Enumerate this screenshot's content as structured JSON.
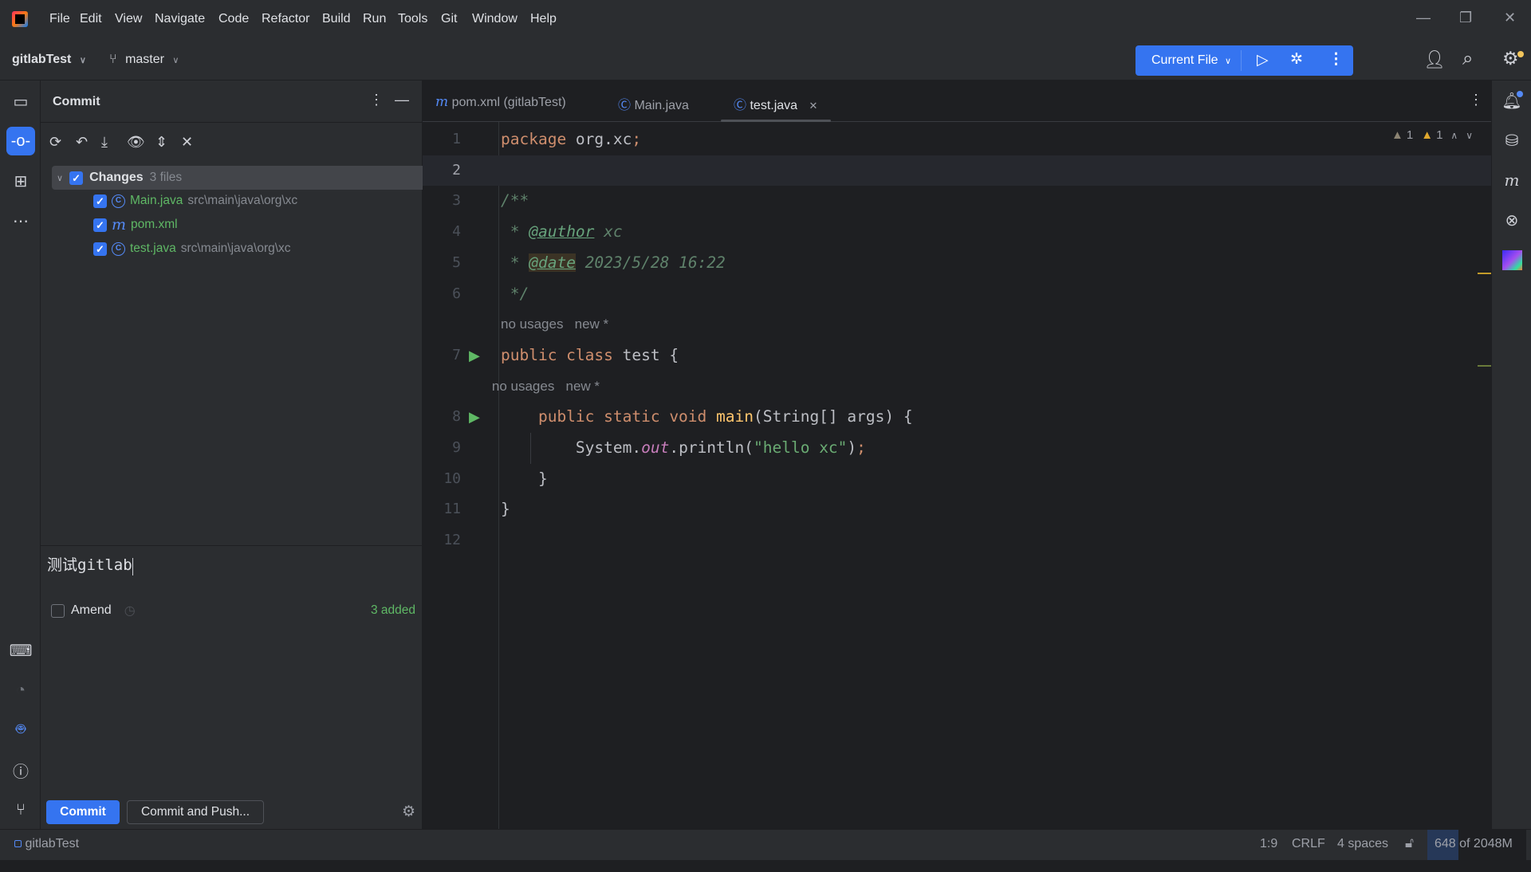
{
  "menubar": {
    "items": [
      "File",
      "Edit",
      "View",
      "Navigate",
      "Code",
      "Refactor",
      "Build",
      "Run",
      "Tools",
      "Git",
      "Window",
      "Help"
    ],
    "window_controls": [
      "minimize",
      "restore",
      "close"
    ]
  },
  "toolbar": {
    "project": "gitlabTest",
    "branch": "master",
    "run_config": "Current File"
  },
  "commit_panel": {
    "title": "Commit",
    "changes_label": "Changes",
    "changes_count": "3 files",
    "files": [
      {
        "name": "Main.java",
        "path": "src\\main\\java\\org\\xc",
        "icon": "class-icon"
      },
      {
        "name": "pom.xml",
        "path": "",
        "icon": "maven-icon"
      },
      {
        "name": "test.java",
        "path": "src\\main\\java\\org\\xc",
        "icon": "class-icon"
      }
    ],
    "amend_label": "Amend",
    "added_status": "3 added",
    "message": "测试gitlab",
    "commit_button": "Commit",
    "commit_push_button": "Commit and Push..."
  },
  "editor": {
    "tabs": [
      {
        "label": "pom.xml (gitlabTest)",
        "icon": "maven-icon"
      },
      {
        "label": "Main.java",
        "icon": "class-icon"
      },
      {
        "label": "test.java",
        "icon": "class-icon",
        "active": true
      }
    ],
    "warnings_weak": "1",
    "warnings": "1",
    "rows": [
      {
        "ln": "1",
        "tokens": [
          [
            "kw",
            "package "
          ],
          [
            "id",
            "org.xc"
          ],
          [
            "kw",
            ";"
          ]
        ]
      },
      {
        "ln": "2",
        "tokens": [],
        "current": true
      },
      {
        "ln": "3",
        "tokens": [
          [
            "cm",
            "/**"
          ]
        ]
      },
      {
        "ln": "4",
        "tokens": [
          [
            "cm",
            " * "
          ],
          [
            "tag",
            "@author"
          ],
          [
            "cm",
            " xc"
          ]
        ]
      },
      {
        "ln": "5",
        "tokens": [
          [
            "cm",
            " * "
          ],
          [
            "tagh",
            "@date"
          ],
          [
            "cm",
            " 2023/5/28 16:22"
          ]
        ]
      },
      {
        "ln": "6",
        "tokens": [
          [
            "cm",
            " */"
          ]
        ]
      },
      {
        "ln": "",
        "inlay": "no usages   new *"
      },
      {
        "ln": "7",
        "run": true,
        "tokens": [
          [
            "kw",
            "public class "
          ],
          [
            "id",
            "test {"
          ]
        ]
      },
      {
        "ln": "",
        "inlay": "    no usages   new *",
        "indent": 1
      },
      {
        "ln": "8",
        "run": true,
        "tokens": [
          [
            "kw",
            "    public static void "
          ],
          [
            "mt",
            "main"
          ],
          [
            "id",
            "(String[] args) {"
          ]
        ]
      },
      {
        "ln": "9",
        "tokens": [
          [
            "id",
            "        System."
          ],
          [
            "fld",
            "out"
          ],
          [
            "id",
            ".println("
          ],
          [
            "str",
            "\"hello xc\""
          ],
          [
            "id",
            ")"
          ],
          [
            "kw",
            ";"
          ]
        ]
      },
      {
        "ln": "10",
        "tokens": [
          [
            "id",
            "    }"
          ]
        ]
      },
      {
        "ln": "11",
        "tokens": [
          [
            "id",
            "}"
          ]
        ]
      },
      {
        "ln": "12",
        "tokens": []
      }
    ]
  },
  "statusbar": {
    "project": "gitlabTest",
    "position": "1:9",
    "line_ending": "CRLF",
    "indent": "4 spaces",
    "memory": "648 of 2048M"
  }
}
